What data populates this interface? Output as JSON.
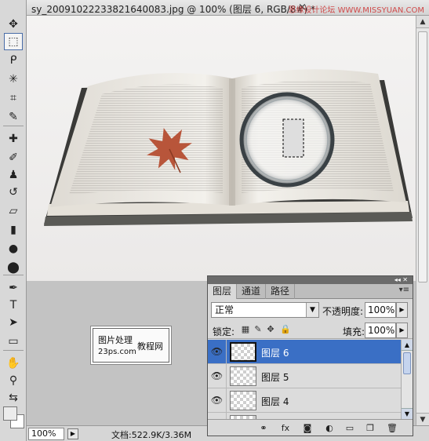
{
  "document": {
    "title": "sy_20091022233821640083.jpg @ 100% (图层 6, RGB/8#) *",
    "close_glyph": "×",
    "watermark": "思缘设计论坛 WWW.MISSYUAN.COM"
  },
  "toolbox": {
    "tools": [
      {
        "name": "move-tool",
        "glyph": "✥"
      },
      {
        "name": "marquee-tool",
        "glyph": "⬚",
        "active": true
      },
      {
        "name": "lasso-tool",
        "glyph": "ᑭ"
      },
      {
        "name": "magic-wand-tool",
        "glyph": "✳"
      },
      {
        "name": "crop-tool",
        "glyph": "⌗"
      },
      {
        "name": "eyedropper-tool",
        "glyph": "✎"
      },
      {
        "name": "healing-tool",
        "glyph": "✚"
      },
      {
        "name": "brush-tool",
        "glyph": "✐"
      },
      {
        "name": "stamp-tool",
        "glyph": "♟"
      },
      {
        "name": "history-brush-tool",
        "glyph": "↺"
      },
      {
        "name": "eraser-tool",
        "glyph": "▱"
      },
      {
        "name": "gradient-tool",
        "glyph": "▮"
      },
      {
        "name": "blur-tool",
        "glyph": "●"
      },
      {
        "name": "dodge-tool",
        "glyph": "⬤"
      },
      {
        "name": "pen-tool",
        "glyph": "✒"
      },
      {
        "name": "type-tool",
        "glyph": "T"
      },
      {
        "name": "path-selection-tool",
        "glyph": "➤"
      },
      {
        "name": "shape-tool",
        "glyph": "▭"
      },
      {
        "name": "hand-tool",
        "glyph": "✋"
      },
      {
        "name": "zoom-tool",
        "glyph": "⚲"
      },
      {
        "name": "swap-colors-tool",
        "glyph": "⇆"
      }
    ]
  },
  "canvas": {
    "logo": {
      "line1": "图片处理",
      "line2": "23ps.com",
      "line3": "教程网"
    }
  },
  "statusbar": {
    "zoom": "100%",
    "doc_size": "文档:522.9K/3.36M"
  },
  "layers_panel": {
    "tabs": [
      {
        "label": "图层",
        "active": true
      },
      {
        "label": "通道",
        "active": false
      },
      {
        "label": "路径",
        "active": false
      }
    ],
    "blend_mode": "正常",
    "opacity_label": "不透明度:",
    "opacity_value": "100%",
    "lock_label": "锁定:",
    "fill_label": "填充:",
    "fill_value": "100%",
    "layers": [
      {
        "name": "图层 6",
        "selected": true,
        "visible": true
      },
      {
        "name": "图层 5",
        "selected": false,
        "visible": true
      },
      {
        "name": "图层 4",
        "selected": false,
        "visible": true
      },
      {
        "name": "",
        "selected": false,
        "visible": false
      }
    ],
    "footer_buttons": [
      {
        "name": "link-layers-icon",
        "glyph": "⚭"
      },
      {
        "name": "layer-style-icon",
        "glyph": "fx"
      },
      {
        "name": "layer-mask-icon",
        "glyph": "◙"
      },
      {
        "name": "adjustment-layer-icon",
        "glyph": "◐"
      },
      {
        "name": "new-group-icon",
        "glyph": "▭"
      },
      {
        "name": "new-layer-icon",
        "glyph": "❐"
      },
      {
        "name": "delete-layer-icon",
        "glyph": "🗑"
      }
    ]
  }
}
